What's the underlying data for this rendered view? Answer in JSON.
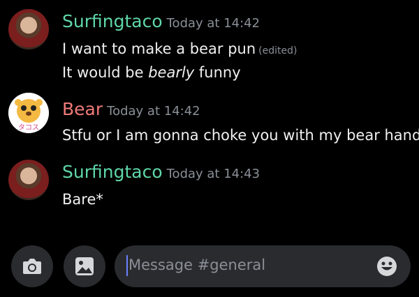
{
  "messages": [
    {
      "username": "Surfingtaco",
      "username_color": "#5fd7a8",
      "timestamp": "Today at 14:42",
      "lines": [
        {
          "text": "I want to make a bear pun",
          "edited": "(edited)"
        },
        {
          "pre": "It would be ",
          "italic": "bearly",
          "post": " funny"
        }
      ]
    },
    {
      "username": "Bear",
      "username_color": "#f07a7a",
      "timestamp": "Today at 14:42",
      "avatar_text": "タコス",
      "lines": [
        {
          "text": "Stfu or I am gonna choke you with my bear hands"
        }
      ]
    },
    {
      "username": "Surfingtaco",
      "username_color": "#5fd7a8",
      "timestamp": "Today at 14:43",
      "lines": [
        {
          "text": "Bare*"
        }
      ]
    }
  ],
  "composer": {
    "placeholder": "Message #general",
    "camera_icon": "camera-icon",
    "image_icon": "image-icon",
    "emoji_icon": "emoji-icon"
  }
}
